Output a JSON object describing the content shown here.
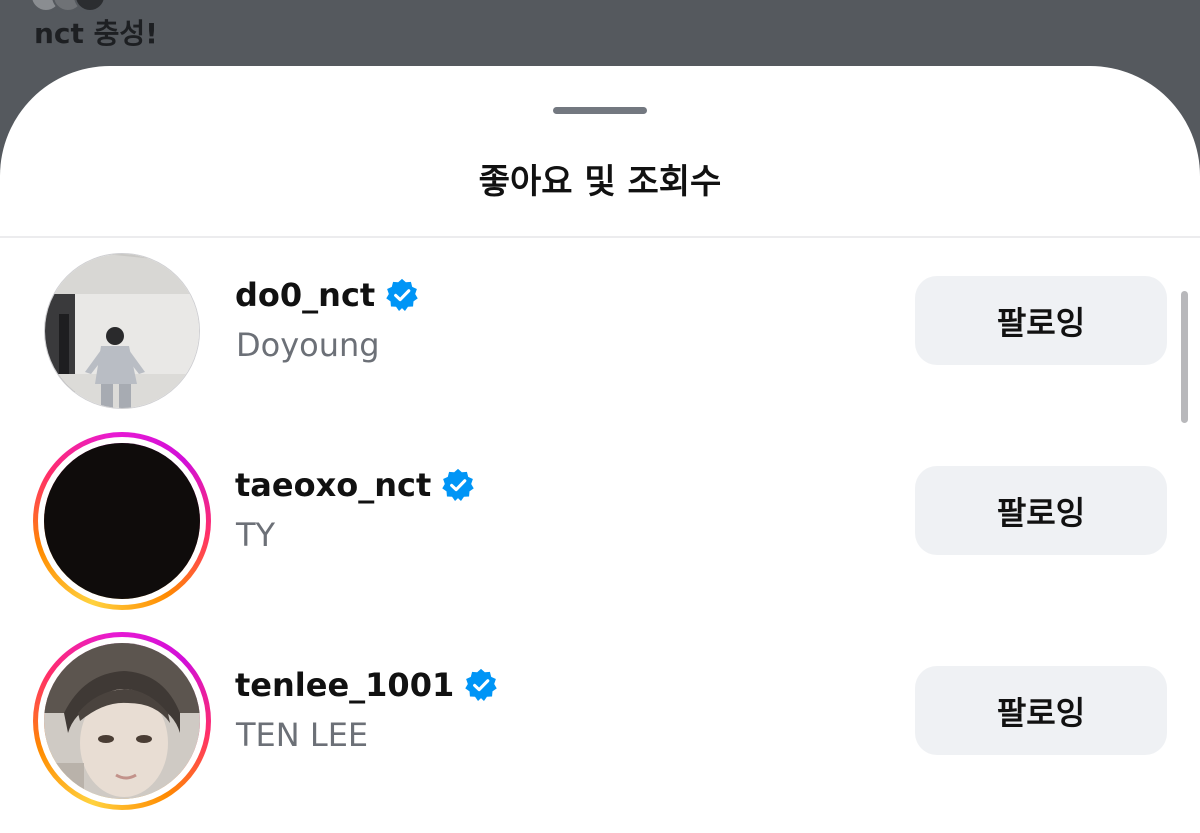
{
  "background": {
    "caption": "nct 충성!"
  },
  "sheet": {
    "title": "좋아요 및 조회수"
  },
  "users": [
    {
      "username": "do0_nct",
      "display_name": "Doyoung",
      "verified": true,
      "has_story_ring": false,
      "follow_label": "팔로잉"
    },
    {
      "username": "taeoxo_nct",
      "display_name": "TY",
      "verified": true,
      "has_story_ring": true,
      "follow_label": "팔로잉"
    },
    {
      "username": "tenlee_1001",
      "display_name": "TEN LEE",
      "verified": true,
      "has_story_ring": true,
      "follow_label": "팔로잉"
    }
  ],
  "colors": {
    "verified_blue": "#0095f6",
    "button_bg": "#eff1f4",
    "secondary_text": "#6c7077"
  },
  "icons": {
    "verified": "verified-badge-icon"
  }
}
